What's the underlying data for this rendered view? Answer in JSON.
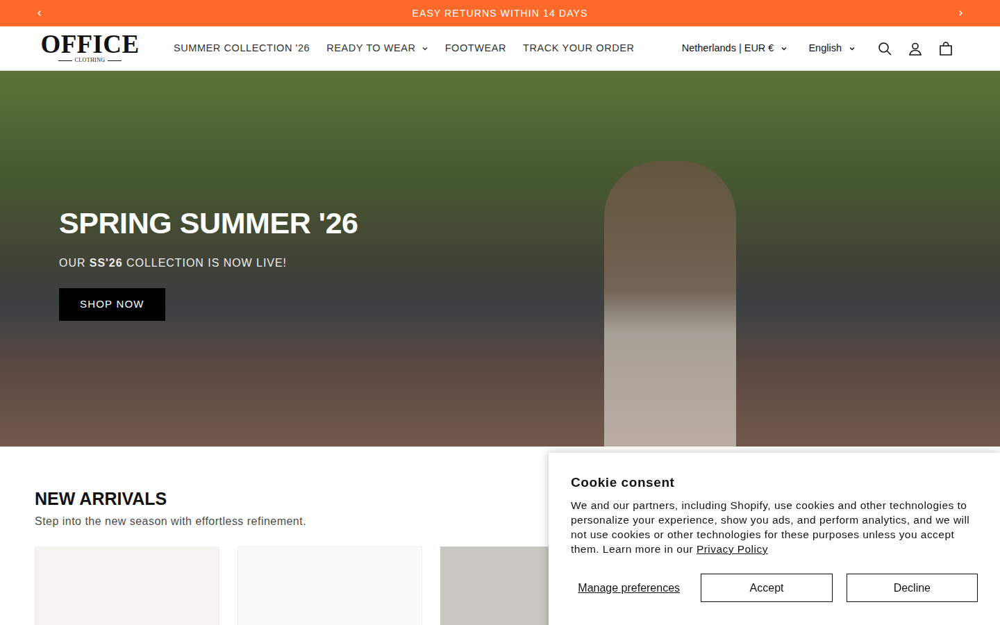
{
  "announcement": {
    "text": "EASY RETURNS WITHIN 14 DAYS"
  },
  "header": {
    "logo": {
      "title": "OFFICE",
      "subtitle": "CLOTHING"
    },
    "nav": [
      {
        "label": "SUMMER COLLECTION '26",
        "has_dropdown": false
      },
      {
        "label": "READY TO WEAR",
        "has_dropdown": true
      },
      {
        "label": "FOOTWEAR",
        "has_dropdown": false
      },
      {
        "label": "TRACK YOUR ORDER",
        "has_dropdown": false
      }
    ],
    "country": "Netherlands | EUR €",
    "language": "English"
  },
  "hero": {
    "title": "SPRING SUMMER '26",
    "subtitle_parts": [
      {
        "text": "OUR ",
        "bold": false
      },
      {
        "text": "SS'26",
        "bold": true
      },
      {
        "text": " COLLECTION IS NOW LIVE!",
        "bold": false
      }
    ],
    "button": "SHOP NOW"
  },
  "new_arrivals": {
    "title": "NEW ARRIVALS",
    "subtitle": "Step into the new season with effortless refinement."
  },
  "cookie": {
    "title": "Cookie consent",
    "text": "We and our partners, including Shopify, use cookies and other technologies to personalize your experience, show you ads, and perform analytics, and we will not use cookies or other technologies for these purposes unless you accept them. Learn more in our ",
    "link": "Privacy Policy",
    "manage": "Manage preferences",
    "buttons": [
      "Accept",
      "Decline"
    ]
  }
}
